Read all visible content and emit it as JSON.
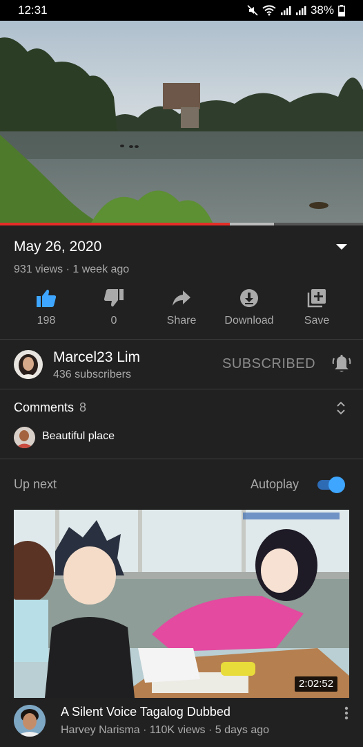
{
  "status_bar": {
    "time": "12:31",
    "battery": "38%",
    "icons": [
      "mute-icon",
      "wifi-icon",
      "signal-icon",
      "signal-icon",
      "battery-icon"
    ]
  },
  "player": {
    "played_fraction": 0.633,
    "buffered_fraction": 0.755
  },
  "video": {
    "title": "May 26, 2020",
    "meta": "931 views · 1 week ago"
  },
  "actions": [
    {
      "label": "198",
      "icon": "thumbs-up-icon",
      "active": true
    },
    {
      "label": "0",
      "icon": "thumbs-down-icon",
      "active": false
    },
    {
      "label": "Share",
      "icon": "share-icon",
      "active": false
    },
    {
      "label": "Download",
      "icon": "download-icon",
      "active": false
    },
    {
      "label": "Save",
      "icon": "save-to-playlist-icon",
      "active": false
    }
  ],
  "channel": {
    "name": "Marcel23 Lim",
    "subscribers": "436 subscribers",
    "subscribe_state": "SUBSCRIBED"
  },
  "comments": {
    "title": "Comments",
    "count": "8",
    "top_comment": "Beautiful place"
  },
  "up_next": {
    "label": "Up next",
    "autoplay_label": "Autoplay",
    "autoplay_on": true,
    "video": {
      "duration": "2:02:52",
      "title": "A Silent Voice Tagalog Dubbed",
      "meta": "Harvey Narisma · 110K views · 5 days ago"
    }
  },
  "colors": {
    "background": "#212121",
    "accent_blue": "#3ea6ff",
    "progress_red": "#e52d27",
    "secondary_text": "#aaaaaa"
  }
}
